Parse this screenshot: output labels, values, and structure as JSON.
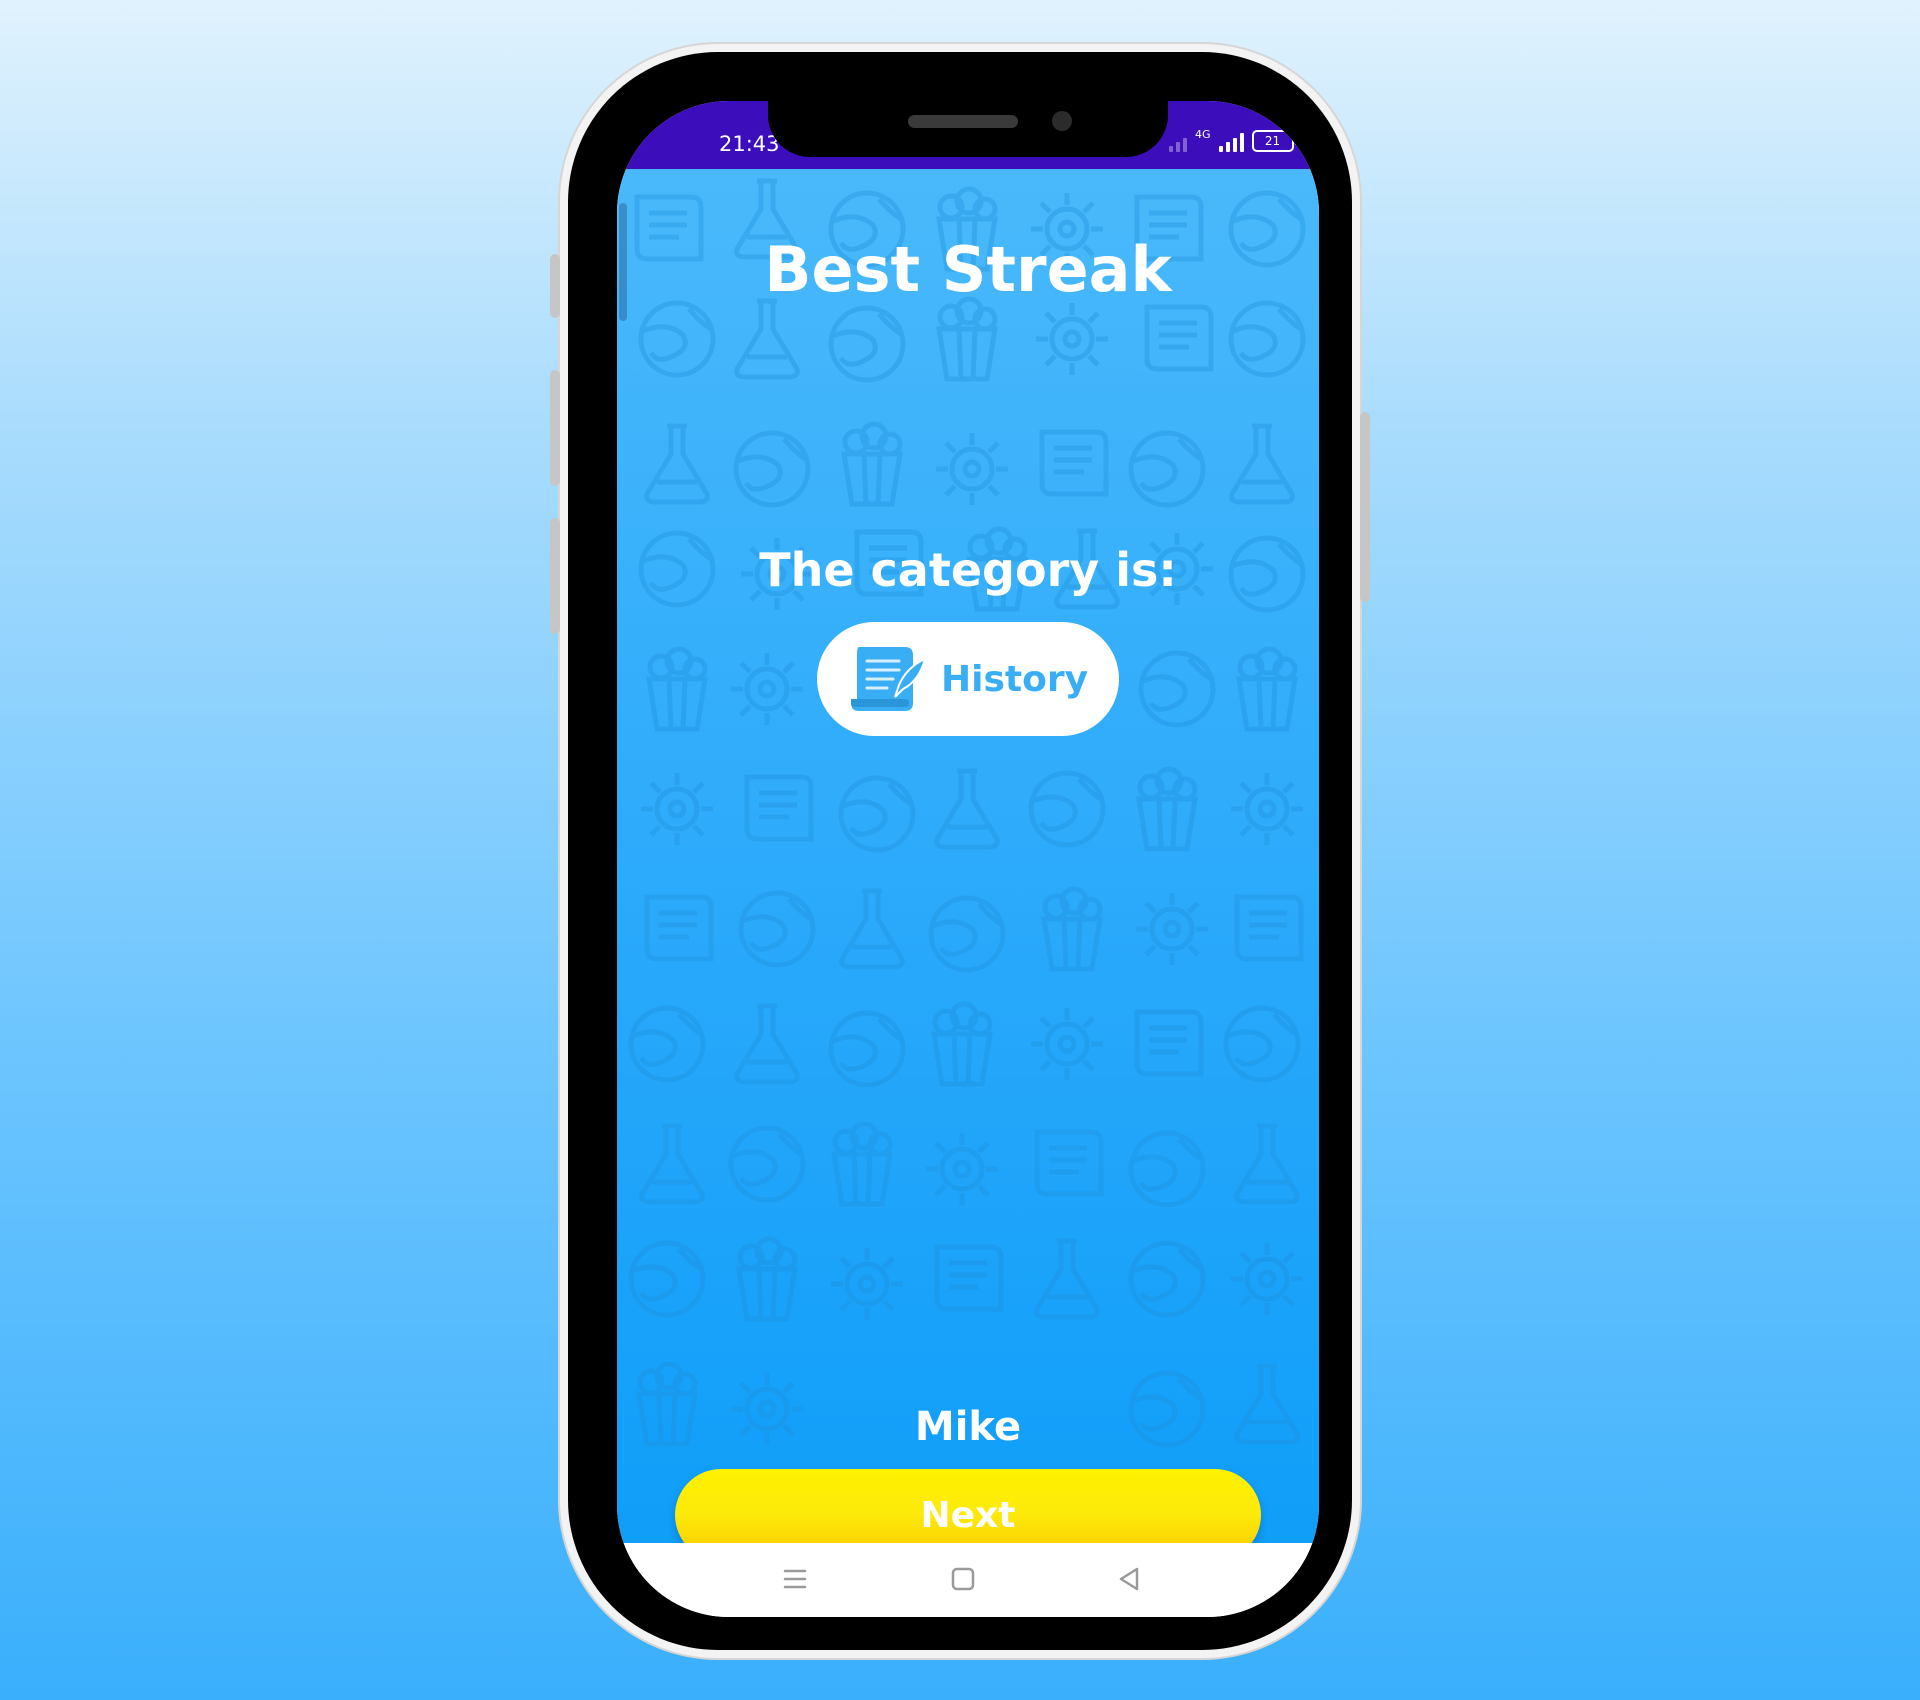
{
  "status_bar": {
    "time": "21:43",
    "network_type": "4G",
    "battery_level": "21",
    "background_color": "#3c0dbb"
  },
  "screen": {
    "title": "Best Streak",
    "prompt": "The category is:",
    "category": {
      "label": "History",
      "icon": "scroll-quill-icon",
      "text_color": "#3aaef5"
    },
    "player_name": "Mike",
    "next_label": "Next",
    "background_pattern_icons": [
      "scroll-icon",
      "flask-icon",
      "globe-icon",
      "popcorn-icon",
      "gear-icon"
    ]
  },
  "nav_bar": {
    "buttons": [
      "menu-icon",
      "home-square-icon",
      "back-triangle-icon"
    ]
  },
  "colors": {
    "accent_yellow": "#fce90a",
    "app_blue": "#2aa9fb"
  }
}
